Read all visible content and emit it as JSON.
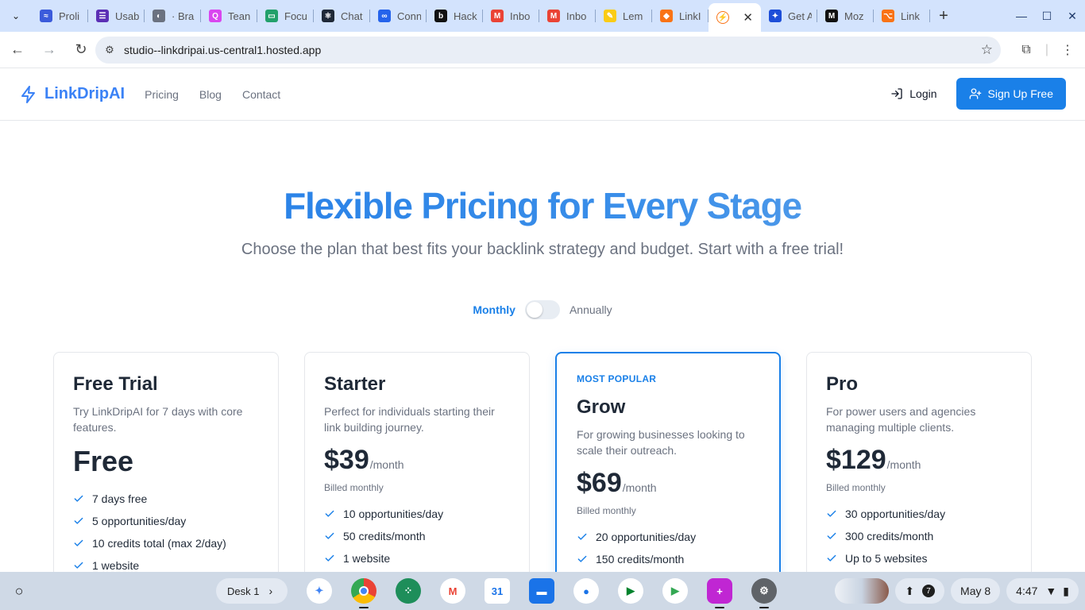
{
  "browser": {
    "tabs": [
      {
        "title": "Proli",
        "color": "#3b5bdb",
        "glyph": "≈"
      },
      {
        "title": "Usab",
        "color": "#5b2fb5",
        "glyph": "☰"
      },
      {
        "title": "· Bra",
        "color": "#6b7280",
        "glyph": "◐"
      },
      {
        "title": "Tean",
        "color": "#d946ef",
        "glyph": "Q"
      },
      {
        "title": "Focu",
        "color": "#22a06b",
        "glyph": "▭"
      },
      {
        "title": "Chat",
        "color": "#1f2937",
        "glyph": "⚛"
      },
      {
        "title": "Conn",
        "color": "#2563eb",
        "glyph": "∞"
      },
      {
        "title": "Hack",
        "color": "#111111",
        "glyph": "b"
      },
      {
        "title": "Inbo",
        "color": "#ea4335",
        "glyph": "M"
      },
      {
        "title": "Inbo",
        "color": "#ea4335",
        "glyph": "M"
      },
      {
        "title": "Lem",
        "color": "#facc15",
        "glyph": "✎"
      },
      {
        "title": "LinkI",
        "color": "#f97316",
        "glyph": "◆"
      }
    ],
    "active_tab": {
      "title": "",
      "close_label": "✕"
    },
    "tabs_after": [
      {
        "title": "Get A",
        "color": "#1d4ed8",
        "glyph": "✦"
      },
      {
        "title": "Moz",
        "color": "#111111",
        "glyph": "M"
      },
      {
        "title": "Link",
        "color": "#f97316",
        "glyph": "⌥"
      }
    ],
    "url": "studio--linkdripai.us-central1.hosted.app"
  },
  "site": {
    "brand": "LinkDripAI",
    "nav": [
      "Pricing",
      "Blog",
      "Contact"
    ],
    "login": "Login",
    "signup": "Sign Up Free"
  },
  "hero": {
    "title": "Flexible Pricing for Every Stage",
    "subtitle": "Choose the plan that best fits your backlink strategy and budget. Start with a free trial!"
  },
  "billing": {
    "monthly": "Monthly",
    "annually": "Annually",
    "annual_selected": false
  },
  "plans": [
    {
      "name": "Free Trial",
      "description": "Try LinkDripAI for 7 days with core features.",
      "price": "Free",
      "period": "",
      "billed": "",
      "features": [
        "7 days free",
        "5 opportunities/day",
        "10 credits total (max 2/day)",
        "1 website"
      ]
    },
    {
      "name": "Starter",
      "description": "Perfect for individuals starting their link building journey.",
      "price": "$39",
      "period": "/month",
      "billed": "Billed monthly",
      "features": [
        "10 opportunities/day",
        "50 credits/month",
        "1 website"
      ]
    },
    {
      "badge": "MOST POPULAR",
      "name": "Grow",
      "description": "For growing businesses looking to scale their outreach.",
      "price": "$69",
      "period": "/month",
      "billed": "Billed monthly",
      "features": [
        "20 opportunities/day",
        "150 credits/month"
      ]
    },
    {
      "name": "Pro",
      "description": "For power users and agencies managing multiple clients.",
      "price": "$129",
      "period": "/month",
      "billed": "Billed monthly",
      "features": [
        "30 opportunities/day",
        "300 credits/month",
        "Up to 5 websites"
      ]
    }
  ],
  "shelf": {
    "desk": "Desk 1",
    "notification_count": "7",
    "date": "May 8",
    "time": "4:47"
  },
  "colors": {
    "accent": "#1a80e8",
    "brand": "#3b82f6"
  }
}
